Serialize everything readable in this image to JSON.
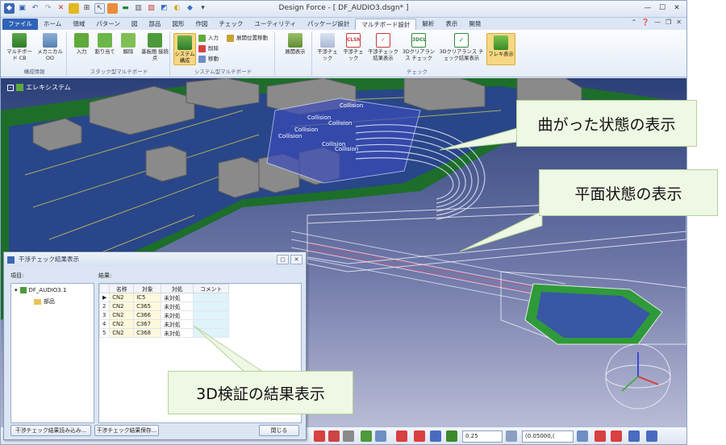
{
  "window": {
    "title": "Design Force - [ DF_AUDIO3.dsgn* ]"
  },
  "tabs": [
    "ファイル",
    "ホーム",
    "領域",
    "パターン",
    "図",
    "部品",
    "図形",
    "作図",
    "チェック",
    "ユーティリティ",
    "パッケージ設計",
    "マルチボード設計",
    "解析",
    "表示",
    "開発"
  ],
  "active_tab": "マルチボード設計",
  "ribbon": {
    "groups": [
      {
        "label": "構成情報",
        "buttons": [
          "マルチボード CB",
          "メカニカル OO"
        ]
      },
      {
        "label": "スタック型マルチボード",
        "buttons": [
          "入力",
          "割り当て",
          "解除",
          "基板間 接続点"
        ]
      },
      {
        "label": "システム型マルチボード",
        "main": "システム 構成",
        "small": [
          "入力",
          "削除",
          "移動"
        ],
        "extra": "展開位置移動"
      },
      {
        "label": "",
        "buttons": [
          "展開表示"
        ]
      },
      {
        "label": "チェック",
        "buttons": [
          "干渉チェック",
          "干渉チェック",
          "干渉チェック 結果表示",
          "3Dクリアランス チェック",
          "3Dクリアランス チェック結果表示",
          "フレキ表示"
        ]
      }
    ],
    "check_icon_texts": [
      "CLSN",
      "3DCL"
    ]
  },
  "viewport": {
    "root_label": "エレキシステム",
    "collision_labels": [
      "Collision",
      "Collision",
      "Collision",
      "Collision",
      "Collision",
      "Collision",
      "Collision"
    ]
  },
  "bottom_toolbar": {
    "value1": "0.25",
    "value2": "(0.05000,("
  },
  "dialog": {
    "title": "干渉チェック結果表示",
    "tree_label": "項目:",
    "results_label": "結果:",
    "tree": [
      "DF_AUDIO3.1",
      "部品"
    ],
    "columns": [
      "",
      "名称",
      "対象",
      "対処",
      "コメント"
    ],
    "rows": [
      {
        "no": "1",
        "name": "CN2",
        "target": "IC5",
        "action": "未対処",
        "comment": ""
      },
      {
        "no": "2",
        "name": "CN2",
        "target": "C365",
        "action": "未対処",
        "comment": ""
      },
      {
        "no": "3",
        "name": "CN2",
        "target": "C366",
        "action": "未対処",
        "comment": ""
      },
      {
        "no": "4",
        "name": "CN2",
        "target": "C367",
        "action": "未対処",
        "comment": ""
      },
      {
        "no": "5",
        "name": "CN2",
        "target": "C368",
        "action": "未対処",
        "comment": ""
      }
    ],
    "buttons": [
      "干渉チェック結果読み込み...",
      "干渉チェック結果保存...",
      "閉じる"
    ]
  },
  "callouts": [
    "曲がった状態の表示",
    "平面状態の表示",
    "3D検証の結果表示"
  ]
}
